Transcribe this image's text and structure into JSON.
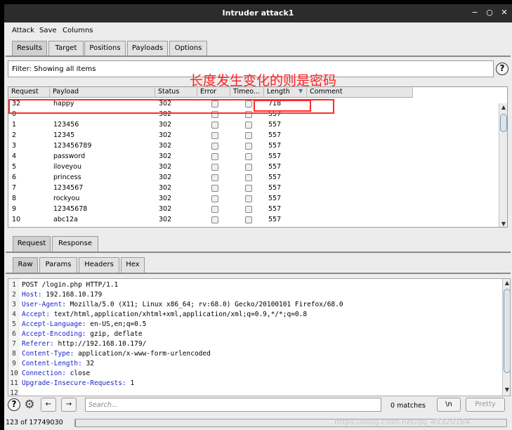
{
  "window": {
    "title": "Intruder attack1",
    "minimize": "−",
    "maximize": "○",
    "close": "✕"
  },
  "menu": [
    "Attack",
    "Save",
    "Columns"
  ],
  "main_tabs": [
    {
      "label": "Results",
      "active": true
    },
    {
      "label": "Target",
      "active": false
    },
    {
      "label": "Positions",
      "active": false
    },
    {
      "label": "Payloads",
      "active": false
    },
    {
      "label": "Options",
      "active": false
    }
  ],
  "filter": {
    "text": "Filter: Showing all items"
  },
  "help_icon": "?",
  "annotation": "长度发生变化的则是密码",
  "table": {
    "columns": [
      "Request",
      "Payload",
      "Status",
      "Error",
      "Timeo...",
      "Length",
      "Comment"
    ],
    "sort_indicator": "▼",
    "rows": [
      {
        "request": "32",
        "payload": "happy",
        "status": "302",
        "length": "718"
      },
      {
        "request": "0",
        "payload": "",
        "status": "302",
        "length": "557"
      },
      {
        "request": "1",
        "payload": "123456",
        "status": "302",
        "length": "557"
      },
      {
        "request": "2",
        "payload": "12345",
        "status": "302",
        "length": "557"
      },
      {
        "request": "3",
        "payload": "123456789",
        "status": "302",
        "length": "557"
      },
      {
        "request": "4",
        "payload": "password",
        "status": "302",
        "length": "557"
      },
      {
        "request": "5",
        "payload": "iloveyou",
        "status": "302",
        "length": "557"
      },
      {
        "request": "6",
        "payload": "princess",
        "status": "302",
        "length": "557"
      },
      {
        "request": "7",
        "payload": "1234567",
        "status": "302",
        "length": "557"
      },
      {
        "request": "8",
        "payload": "rockyou",
        "status": "302",
        "length": "557"
      },
      {
        "request": "9",
        "payload": "12345678",
        "status": "302",
        "length": "557"
      },
      {
        "request": "10",
        "payload": "abc12a",
        "status": "302",
        "length": "557"
      }
    ]
  },
  "detail_tabs": [
    {
      "label": "Request",
      "active": true
    },
    {
      "label": "Response",
      "active": false
    }
  ],
  "view_tabs": [
    {
      "label": "Raw",
      "active": true
    },
    {
      "label": "Params",
      "active": false
    },
    {
      "label": "Headers",
      "active": false
    },
    {
      "label": "Hex",
      "active": false
    }
  ],
  "request_lines": [
    {
      "n": "1",
      "key": "",
      "value": "POST /login.php HTTP/1.1"
    },
    {
      "n": "2",
      "key": "Host:",
      "value": " 192.168.10.179"
    },
    {
      "n": "3",
      "key": "User-Agent:",
      "value": " Mozilla/5.0 (X11; Linux x86_64; rv:68.0) Gecko/20100101 Firefox/68.0"
    },
    {
      "n": "4",
      "key": "Accept:",
      "value": " text/html,application/xhtml+xml,application/xml;q=0.9,*/*;q=0.8"
    },
    {
      "n": "5",
      "key": "Accept-Language:",
      "value": " en-US,en;q=0.5"
    },
    {
      "n": "6",
      "key": "Accept-Encoding:",
      "value": " gzip, deflate"
    },
    {
      "n": "7",
      "key": "Referer:",
      "value": " http://192.168.10.179/"
    },
    {
      "n": "8",
      "key": "Content-Type:",
      "value": " application/x-www-form-urlencoded"
    },
    {
      "n": "9",
      "key": "Content-Length:",
      "value": " 32"
    },
    {
      "n": "10",
      "key": "Connection:",
      "value": " close"
    },
    {
      "n": "11",
      "key": "Upgrade-Insecure-Requests:",
      "value": " 1"
    },
    {
      "n": "12",
      "key": "",
      "value": ""
    }
  ],
  "toolbar": {
    "help": "?",
    "settings": "⚙",
    "prev": "←",
    "next": "→",
    "search_placeholder": "Search...",
    "matches": "0 matches",
    "newline": "\\n",
    "pretty": "Pretty"
  },
  "status": {
    "progress_text": "123 of 17749030",
    "progress_fraction": 6.9e-06
  },
  "watermark": "https://blog.csdn.net/qq_45320164"
}
